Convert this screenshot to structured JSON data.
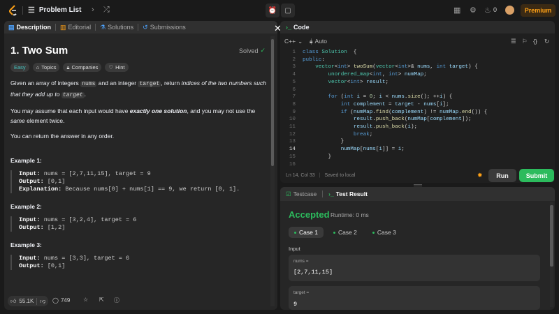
{
  "topbar": {
    "problem_list": "Problem List",
    "coins": "0",
    "premium": "Premium"
  },
  "left": {
    "tabs": [
      "Description",
      "Editorial",
      "Solutions",
      "Submissions"
    ],
    "title": "1. Two Sum",
    "solved": "Solved",
    "tags": [
      "Easy",
      "Topics",
      "Companies",
      "Hint"
    ],
    "p1_a": "Given an array of integers ",
    "p1_nums": "nums",
    "p1_b": " and an integer ",
    "p1_target": "target",
    "p1_c": ", return ",
    "p1_em1": "indices of the two numbers such that they add up to",
    "p1_target2": "target",
    "p1_end": ".",
    "p2_a": "You may assume that each input would have ",
    "p2_em": "exactly one solution",
    "p2_b": ", and you may not use the ",
    "p2_same": "same",
    "p2_c": " element twice.",
    "p3": "You can return the answer in any order.",
    "examples": [
      {
        "head": "Example 1:",
        "input_label": "Input:",
        "input": " nums = [2,7,11,15], target = 9",
        "output_label": "Output:",
        "output": " [0,1]",
        "expl_label": "Explanation:",
        "expl": " Because nums[0] + nums[1] == 9, we return [0, 1]."
      },
      {
        "head": "Example 2:",
        "input_label": "Input:",
        "input": " nums = [3,2,4], target = 6",
        "output_label": "Output:",
        "output": " [1,2]"
      },
      {
        "head": "Example 3:",
        "input_label": "Input:",
        "input": " nums = [3,3], target = 6",
        "output_label": "Output:",
        "output": " [0,1]"
      }
    ],
    "likes": "55.1K",
    "comments": "749"
  },
  "code": {
    "tab": "Code",
    "language": "C++",
    "mode": "Auto",
    "lines": [
      [
        [
          "kw",
          "class "
        ],
        [
          "ty",
          "Solution"
        ],
        [
          "",
          "  {"
        ]
      ],
      [
        [
          "kw",
          "public"
        ],
        [
          "",
          ":"
        ]
      ],
      [
        [
          "",
          "    "
        ],
        [
          "ty",
          "vector"
        ],
        [
          "",
          "<"
        ],
        [
          "kw",
          "int"
        ],
        [
          "",
          "> "
        ],
        [
          "fn",
          "twoSum"
        ],
        [
          "",
          "("
        ],
        [
          "ty",
          "vector"
        ],
        [
          "",
          "<"
        ],
        [
          "kw",
          "int"
        ],
        [
          "",
          ">& "
        ],
        [
          "vr",
          "nums"
        ],
        [
          "",
          ", "
        ],
        [
          "kw",
          "int "
        ],
        [
          "vr",
          "target"
        ],
        [
          "",
          ") {"
        ]
      ],
      [
        [
          "",
          "        "
        ],
        [
          "ty",
          "unordered_map"
        ],
        [
          "",
          "<"
        ],
        [
          "kw",
          "int"
        ],
        [
          "",
          ", "
        ],
        [
          "kw",
          "int"
        ],
        [
          "",
          "> "
        ],
        [
          "vr",
          "numMap"
        ],
        [
          "",
          ";"
        ]
      ],
      [
        [
          "",
          "        "
        ],
        [
          "ty",
          "vector"
        ],
        [
          "",
          "<"
        ],
        [
          "kw",
          "int"
        ],
        [
          "",
          "> "
        ],
        [
          "vr",
          "result"
        ],
        [
          "",
          ";"
        ]
      ],
      [
        [
          "",
          ""
        ]
      ],
      [
        [
          "",
          "        "
        ],
        [
          "kw",
          "for "
        ],
        [
          "",
          "("
        ],
        [
          "kw",
          "int "
        ],
        [
          "vr",
          "i"
        ],
        [
          "",
          " = "
        ],
        [
          "nm",
          "0"
        ],
        [
          "",
          "; "
        ],
        [
          "vr",
          "i"
        ],
        [
          "",
          " < "
        ],
        [
          "vr",
          "nums"
        ],
        [
          "",
          "."
        ],
        [
          "fn",
          "size"
        ],
        [
          "",
          "(); ++"
        ],
        [
          "vr",
          "i"
        ],
        [
          "",
          ") {"
        ]
      ],
      [
        [
          "",
          "            "
        ],
        [
          "kw",
          "int "
        ],
        [
          "vr",
          "complement"
        ],
        [
          "",
          " = "
        ],
        [
          "vr",
          "target"
        ],
        [
          "",
          " - "
        ],
        [
          "vr",
          "nums"
        ],
        [
          "",
          "["
        ],
        [
          "vr",
          "i"
        ],
        [
          "",
          "];"
        ]
      ],
      [
        [
          "",
          "            "
        ],
        [
          "kw",
          "if "
        ],
        [
          "",
          "("
        ],
        [
          "vr",
          "numMap"
        ],
        [
          "",
          "."
        ],
        [
          "fn",
          "find"
        ],
        [
          "",
          "("
        ],
        [
          "vr",
          "complement"
        ],
        [
          "",
          ") != "
        ],
        [
          "vr",
          "numMap"
        ],
        [
          "",
          "."
        ],
        [
          "fn",
          "end"
        ],
        [
          "",
          "()) {"
        ]
      ],
      [
        [
          "",
          "                "
        ],
        [
          "vr",
          "result"
        ],
        [
          "",
          "."
        ],
        [
          "fn",
          "push_back"
        ],
        [
          "",
          "("
        ],
        [
          "vr",
          "numMap"
        ],
        [
          "",
          "["
        ],
        [
          "vr",
          "complement"
        ],
        [
          "",
          "]);"
        ]
      ],
      [
        [
          "",
          "                "
        ],
        [
          "vr",
          "result"
        ],
        [
          "",
          "."
        ],
        [
          "fn",
          "push_back"
        ],
        [
          "",
          "("
        ],
        [
          "vr",
          "i"
        ],
        [
          "",
          ");"
        ]
      ],
      [
        [
          "",
          "                "
        ],
        [
          "kw",
          "break"
        ],
        [
          "",
          ";"
        ]
      ],
      [
        [
          "",
          "            }"
        ]
      ],
      [
        [
          "",
          "            "
        ],
        [
          "vr",
          "numMap"
        ],
        [
          "",
          "["
        ],
        [
          "vr",
          "nums"
        ],
        [
          "",
          "["
        ],
        [
          "vr",
          "i"
        ],
        [
          "",
          "]] = "
        ],
        [
          "vr",
          "i"
        ],
        [
          "",
          ";"
        ]
      ],
      [
        [
          "",
          "        }"
        ]
      ],
      [
        [
          "",
          ""
        ]
      ]
    ],
    "line_numbers": [
      "1",
      "2",
      "3",
      "4",
      "5",
      "6",
      "7",
      "8",
      "9",
      "10",
      "11",
      "12",
      "13",
      "14",
      "15",
      "16"
    ],
    "current_line": "14",
    "cursor": "Ln 14, Col 33",
    "saved": "Saved to local",
    "run": "Run",
    "submit": "Submit"
  },
  "test": {
    "tabs": [
      "Testcase",
      "Test Result"
    ],
    "status": "Accepted",
    "runtime": "Runtime: 0 ms",
    "cases": [
      "Case 1",
      "Case 2",
      "Case 3"
    ],
    "input_label": "Input",
    "vars": [
      {
        "name": "nums =",
        "value": "[2,7,11,15]"
      },
      {
        "name": "target =",
        "value": "9"
      }
    ]
  }
}
